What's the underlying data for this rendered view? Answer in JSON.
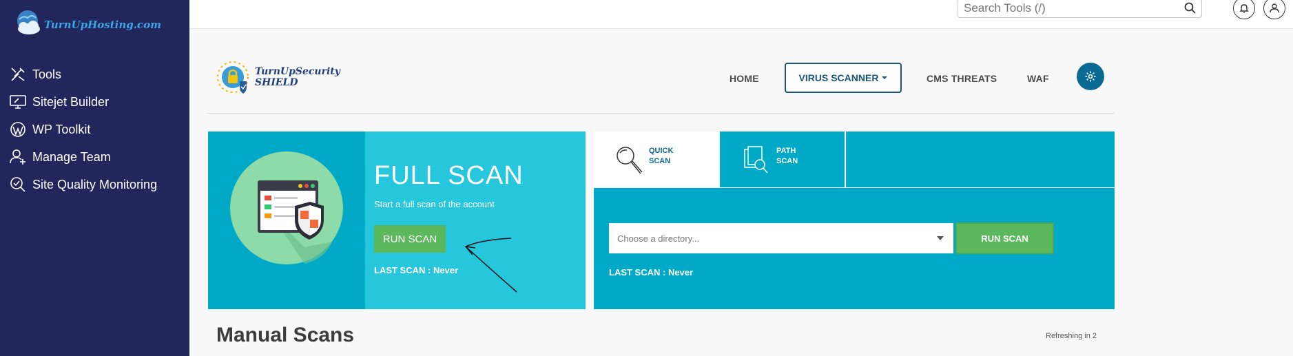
{
  "sidebar": {
    "brand": "TurnUpHosting.com",
    "items": [
      {
        "label": "Tools",
        "icon": "tools-icon"
      },
      {
        "label": "Sitejet Builder",
        "icon": "monitor-edit-icon"
      },
      {
        "label": "WP Toolkit",
        "icon": "wordpress-icon"
      },
      {
        "label": "Manage Team",
        "icon": "user-plus-icon"
      },
      {
        "label": "Site Quality Monitoring",
        "icon": "search-check-icon"
      }
    ]
  },
  "topbar": {
    "search_placeholder": "Search Tools (/)"
  },
  "header": {
    "logo_line1": "TurnUpSecurity",
    "logo_line2": "SHIELD",
    "nav": {
      "home": "HOME",
      "virus_scanner": "VIRUS SCANNER",
      "cms_threats": "CMS THREATS",
      "waf": "WAF"
    }
  },
  "full_scan": {
    "title": "FULL SCAN",
    "subtitle": "Start a full scan of the account",
    "run_label": "RUN SCAN",
    "last_scan": "LAST SCAN : Never"
  },
  "quick_scan": {
    "tabs": [
      {
        "line1": "QUICK",
        "line2": "SCAN"
      },
      {
        "line1": "PATH",
        "line2": "SCAN"
      }
    ],
    "directory_placeholder": "Choose a directory...",
    "run_label": "RUN SCAN",
    "last_scan": "LAST SCAN : Never"
  },
  "manual": {
    "title": "Manual Scans",
    "refresh": "Refreshing in 2"
  },
  "colors": {
    "sidebar": "#22265a",
    "teal_dark": "#00a9c5",
    "teal_light": "#26c6dc",
    "green": "#5cb85c",
    "accent_blue": "#0b6a93"
  }
}
